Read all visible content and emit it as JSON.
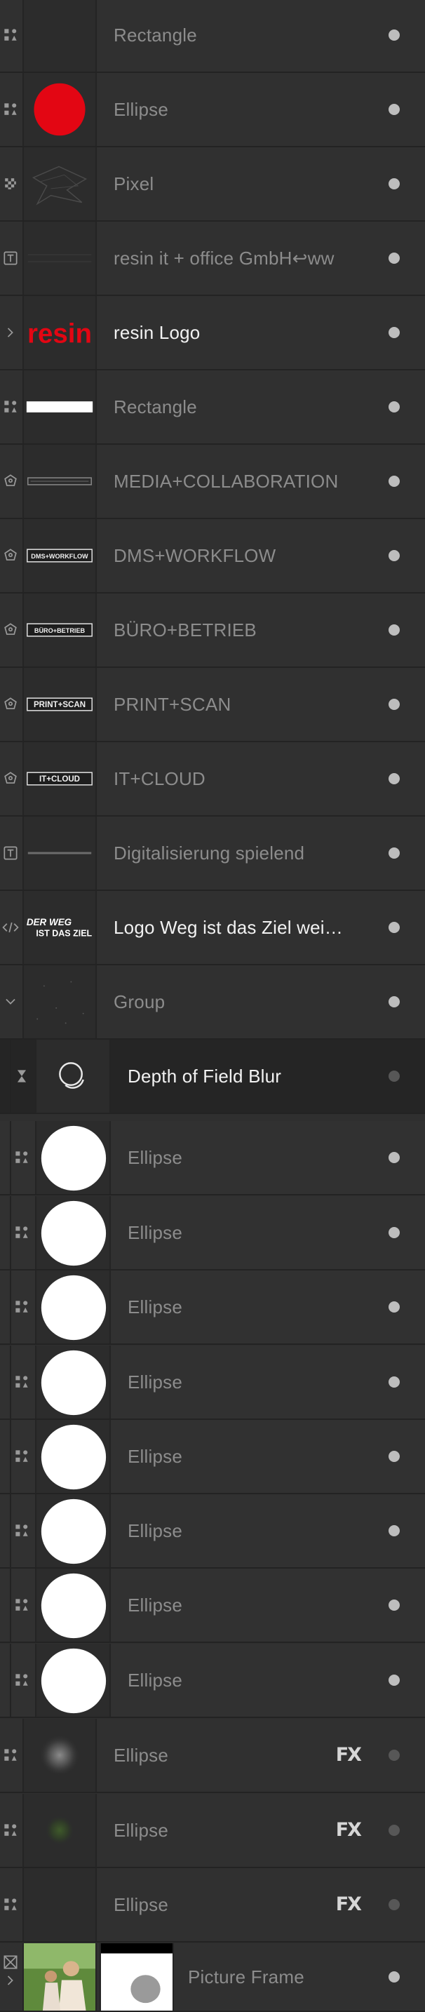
{
  "layers": [
    {
      "label": "Rectangle",
      "icon": "shape-icon",
      "thumb": "blank",
      "bright": false
    },
    {
      "label": "Ellipse",
      "icon": "shape-icon",
      "thumb": "red-circle",
      "bright": false,
      "color": "#e30613"
    },
    {
      "label": "Pixel",
      "icon": "pixel-icon",
      "thumb": "pixel-lines",
      "bright": false
    },
    {
      "label": "resin it + office GmbH↩ww",
      "icon": "text-frame-icon",
      "thumb": "faint-lines",
      "bright": false
    },
    {
      "label": "resin Logo",
      "icon": "chevron-right-icon",
      "thumb": "resin-logo",
      "thumb_text": "resin",
      "bright": true,
      "color": "#e30613"
    },
    {
      "label": "Rectangle",
      "icon": "shape-icon",
      "thumb": "white-bar",
      "bright": false
    },
    {
      "label": "MEDIA+COLLABORATION",
      "icon": "curves-icon",
      "thumb": "thin-box",
      "bright": false
    },
    {
      "label": "DMS+WORKFLOW",
      "icon": "curves-icon",
      "thumb": "boxed-text",
      "thumb_text": "DMS+WORKFLOW",
      "bright": false
    },
    {
      "label": "BÜRO+BETRIEB",
      "icon": "curves-icon",
      "thumb": "boxed-text",
      "thumb_text": "BÜRO+BETRIEB",
      "bright": false
    },
    {
      "label": "PRINT+SCAN",
      "icon": "curves-icon",
      "thumb": "boxed-text",
      "thumb_text": "PRINT+SCAN",
      "bright": false
    },
    {
      "label": "IT+CLOUD",
      "icon": "curves-icon",
      "thumb": "boxed-text",
      "thumb_text": "IT+CLOUD",
      "bright": false
    },
    {
      "label": "Digitalisierung spielend",
      "icon": "text-frame-icon",
      "thumb": "grey-line",
      "bright": false
    },
    {
      "label": "Logo Weg ist das Ziel wei…",
      "icon": "embedded-code-icon",
      "thumb": "weg-logo",
      "thumb_text_1": "DER WEG",
      "thumb_text_2": "IST DAS ZIEL",
      "bright": true
    },
    {
      "label": "Group",
      "icon": "chevron-down-icon",
      "thumb": "dots",
      "bright": false
    },
    {
      "label": "Depth of Field Blur",
      "icon": "hourglass-icon",
      "thumb": "blur-icon",
      "bright": true,
      "child": true,
      "selected": true,
      "dim_dot": true
    },
    {
      "label": "Ellipse",
      "icon": "shape-icon",
      "thumb": "white-circle",
      "bright": false,
      "child": true
    },
    {
      "label": "Ellipse",
      "icon": "shape-icon",
      "thumb": "white-circle",
      "bright": false,
      "child": true
    },
    {
      "label": "Ellipse",
      "icon": "shape-icon",
      "thumb": "white-circle",
      "bright": false,
      "child": true
    },
    {
      "label": "Ellipse",
      "icon": "shape-icon",
      "thumb": "white-circle",
      "bright": false,
      "child": true
    },
    {
      "label": "Ellipse",
      "icon": "shape-icon",
      "thumb": "white-circle",
      "bright": false,
      "child": true
    },
    {
      "label": "Ellipse",
      "icon": "shape-icon",
      "thumb": "white-circle",
      "bright": false,
      "child": true
    },
    {
      "label": "Ellipse",
      "icon": "shape-icon",
      "thumb": "white-circle",
      "bright": false,
      "child": true
    },
    {
      "label": "Ellipse",
      "icon": "shape-icon",
      "thumb": "white-circle",
      "bright": false,
      "child": true
    },
    {
      "label": "Ellipse",
      "icon": "shape-icon",
      "thumb": "blur-grey",
      "bright": false,
      "fx": "FX",
      "dim_dot": true
    },
    {
      "label": "Ellipse",
      "icon": "shape-icon",
      "thumb": "blur-green",
      "bright": false,
      "fx": "FX",
      "dim_dot": true
    },
    {
      "label": "Ellipse",
      "icon": "shape-icon",
      "thumb": "blank",
      "bright": false,
      "fx": "FX",
      "dim_dot": true
    },
    {
      "label": "Picture Frame",
      "icon": "picture-frame-icon",
      "thumb": "picture",
      "bright": false,
      "secondary_icon": "chevron-right-icon"
    }
  ]
}
